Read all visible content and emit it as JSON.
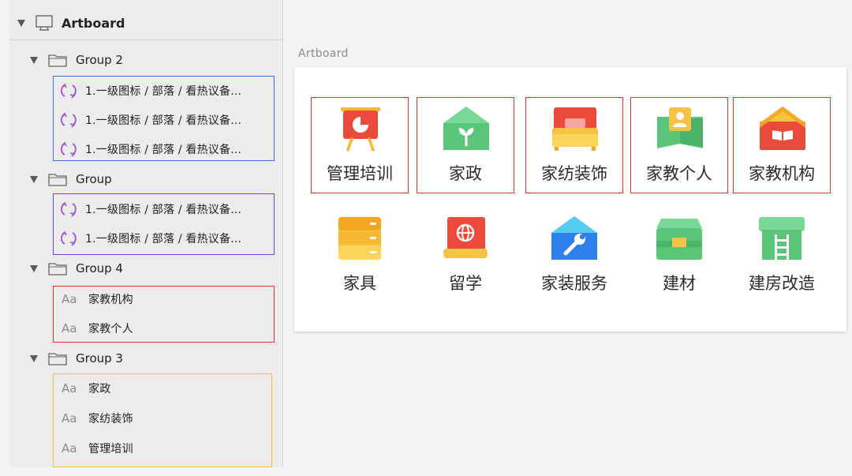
{
  "layers": {
    "artboard_label": "Artboard",
    "groups": [
      {
        "label": "Group 2",
        "children": [
          {
            "kind": "symbol",
            "label": "1.一级图标 / 部落 / 看热议备..."
          },
          {
            "kind": "symbol",
            "label": "1.一级图标 / 部落 / 看热议备..."
          },
          {
            "kind": "symbol",
            "label": "1.一级图标 / 部落 / 看热议备..."
          }
        ],
        "border_color": "#3a6fd8"
      },
      {
        "label": "Group",
        "children": [
          {
            "kind": "symbol",
            "label": "1.一级图标 / 部落 / 看热议备..."
          },
          {
            "kind": "symbol",
            "label": "1.一级图标 / 部落 / 看热议备..."
          }
        ],
        "border_color": "#7b3fd6"
      },
      {
        "label": "Group 4",
        "children": [
          {
            "kind": "text",
            "prefix": "Aa",
            "label": "家教机构"
          },
          {
            "kind": "text",
            "prefix": "Aa",
            "label": "家教个人"
          }
        ],
        "border_color": "#e0322c"
      },
      {
        "label": "Group 3",
        "children": [
          {
            "kind": "text",
            "prefix": "Aa",
            "label": "家政"
          },
          {
            "kind": "text",
            "prefix": "Aa",
            "label": "家纺装饰"
          },
          {
            "kind": "text",
            "prefix": "Aa",
            "label": "管理培训"
          }
        ],
        "border_color": "#f2c23c"
      }
    ]
  },
  "canvas": {
    "artboard_title": "Artboard",
    "selection_color": "#e0322c",
    "grid": [
      {
        "label": "管理培训",
        "icon": "training-board-icon",
        "selected": true
      },
      {
        "label": "家政",
        "icon": "house-sprout-icon",
        "selected": true
      },
      {
        "label": "家纺装饰",
        "icon": "bed-icon",
        "selected": true
      },
      {
        "label": "家教个人",
        "icon": "tutor-person-icon",
        "selected": true
      },
      {
        "label": "家教机构",
        "icon": "school-book-icon",
        "selected": true
      },
      {
        "label": "家具",
        "icon": "cabinet-icon",
        "selected": false
      },
      {
        "label": "留学",
        "icon": "globe-scroll-icon",
        "selected": false
      },
      {
        "label": "家装服务",
        "icon": "wrench-house-icon",
        "selected": false
      },
      {
        "label": "建材",
        "icon": "materials-box-icon",
        "selected": false
      },
      {
        "label": "建房改造",
        "icon": "house-ladder-icon",
        "selected": false
      }
    ]
  }
}
